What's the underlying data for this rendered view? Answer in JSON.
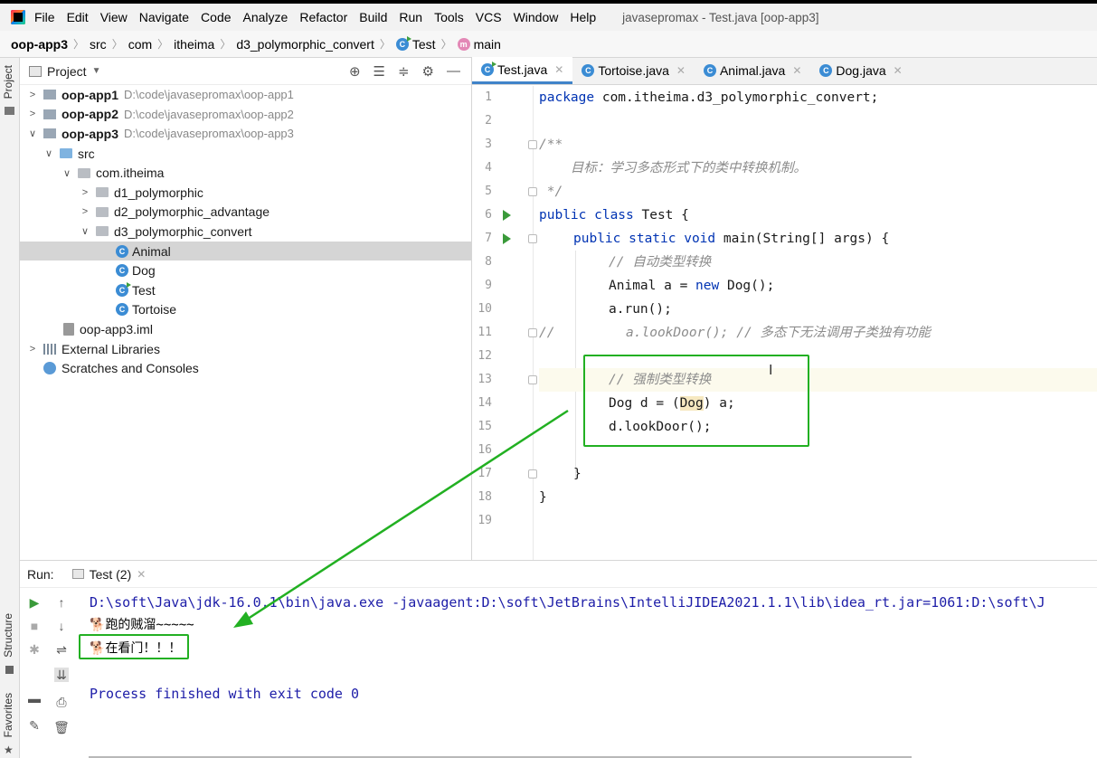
{
  "menubar": {
    "items": [
      "File",
      "Edit",
      "View",
      "Navigate",
      "Code",
      "Analyze",
      "Refactor",
      "Build",
      "Run",
      "Tools",
      "VCS",
      "Window",
      "Help"
    ],
    "window_title": "javasepromax - Test.java [oop-app3]"
  },
  "breadcrumb": {
    "project": "oop-app3",
    "src": "src",
    "com": "com",
    "itheima": "itheima",
    "package": "d3_polymorphic_convert",
    "class": "Test",
    "method": "main"
  },
  "side_labels": {
    "project": "Project",
    "structure": "Structure",
    "favorites": "Favorites"
  },
  "project_panel": {
    "title": "Project",
    "tree": [
      {
        "label": "oop-app1",
        "path": "D:\\code\\javasepromax\\oop-app1"
      },
      {
        "label": "oop-app2",
        "path": "D:\\code\\javasepromax\\oop-app2"
      },
      {
        "label": "oop-app3",
        "path": "D:\\code\\javasepromax\\oop-app3"
      },
      {
        "label": "src"
      },
      {
        "label": "com.itheima"
      },
      {
        "label": "d1_polymorphic"
      },
      {
        "label": "d2_polymorphic_advantage"
      },
      {
        "label": "d3_polymorphic_convert"
      },
      {
        "label": "Animal"
      },
      {
        "label": "Dog"
      },
      {
        "label": "Test"
      },
      {
        "label": "Tortoise"
      },
      {
        "label": "oop-app3.iml"
      },
      {
        "label": "External Libraries"
      },
      {
        "label": "Scratches and Consoles"
      }
    ]
  },
  "editor": {
    "tabs": [
      "Test.java",
      "Tortoise.java",
      "Animal.java",
      "Dog.java"
    ],
    "line_numbers": [
      "1",
      "2",
      "3",
      "4",
      "5",
      "6",
      "7",
      "8",
      "9",
      "10",
      "11",
      "12",
      "13",
      "14",
      "15",
      "16",
      "17",
      "18",
      "19"
    ],
    "code": {
      "l1_kw": "package",
      "l1_rest": " com.itheima.d3_polymorphic_convert;",
      "l3": "/**",
      "l4": "    目标：学习多态形式下的类中转换机制。",
      "l5": " */",
      "l6_kw": "public class",
      "l6_rest": " Test {",
      "l7_kw": "public static void",
      "l7_rest": " main(String[] args) {",
      "l8": "// 自动类型转换",
      "l9_a": "Animal a = ",
      "l9_kw": "new",
      "l9_b": " Dog();",
      "l10": "a.run();",
      "l11": "//         a.lookDoor(); // 多态下无法调用子类独有功能",
      "l13": "// 强制类型转换",
      "l14_a": "Dog d = (",
      "l14_hl": "Dog",
      "l14_b": ") a;",
      "l15": "d.lookDoor();",
      "l17": "}",
      "l18": "}"
    }
  },
  "run_panel": {
    "label": "Run:",
    "tab": "Test (2)",
    "console": {
      "cmd": "D:\\soft\\Java\\jdk-16.0.1\\bin\\java.exe -javaagent:D:\\soft\\JetBrains\\IntelliJIDEA2021.1.1\\lib\\idea_rt.jar=1061:D:\\soft\\J",
      "out1": "跑的贼溜~~~~~",
      "out2": "在看门！！！",
      "exit": "Process finished with exit code 0"
    }
  },
  "colors": {
    "keyword": "#0033b3",
    "comment": "#8c8c8c",
    "annotation_green": "#22b022",
    "console_blue": "#1d1da8"
  }
}
